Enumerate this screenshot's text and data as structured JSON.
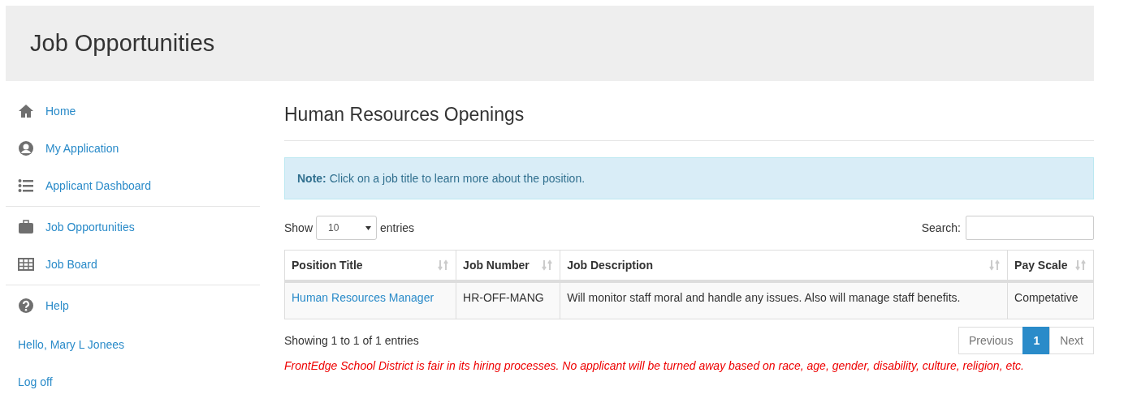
{
  "header": {
    "title": "Job Opportunities"
  },
  "sidebar": {
    "sections": [
      {
        "items": [
          {
            "label": "Home"
          },
          {
            "label": "My Application"
          },
          {
            "label": "Applicant Dashboard"
          }
        ]
      },
      {
        "items": [
          {
            "label": "Job Opportunities"
          },
          {
            "label": "Job Board"
          }
        ]
      },
      {
        "items": [
          {
            "label": "Help"
          }
        ]
      }
    ],
    "greeting": "Hello, Mary L Jonees",
    "logoff": "Log off"
  },
  "main": {
    "title": "Human Resources Openings",
    "note": "**Note:** Click on a job title to learn more about the position.",
    "length": {
      "label_before": "Show",
      "value": "10",
      "label_after": "entries"
    },
    "search": {
      "label": "Search:"
    },
    "table": {
      "columns": [
        {
          "label": "Position Title"
        },
        {
          "label": "Job Number"
        },
        {
          "label": "Job Description"
        },
        {
          "label": "Pay Scale"
        }
      ],
      "rows": [
        {
          "cells": [
            "Human Resources Manager",
            "HR-OFF-MANG",
            "Will monitor staff moral and handle any issues. Also will manage staff benefits.",
            "Competative"
          ]
        }
      ]
    },
    "info": "Showing 1 to 1 of 1 entries",
    "pagination": {
      "previous": {
        "label": "Previous",
        "disabled": true
      },
      "pages": [
        {
          "label": "1",
          "selected": true
        }
      ],
      "next": {
        "label": "Next",
        "disabled": true
      }
    },
    "disclaimer": "FrontEdge School District is fair in its hiring processes. No applicant will be turned away based on race, age, gender, disability, culture, religion, etc."
  }
}
